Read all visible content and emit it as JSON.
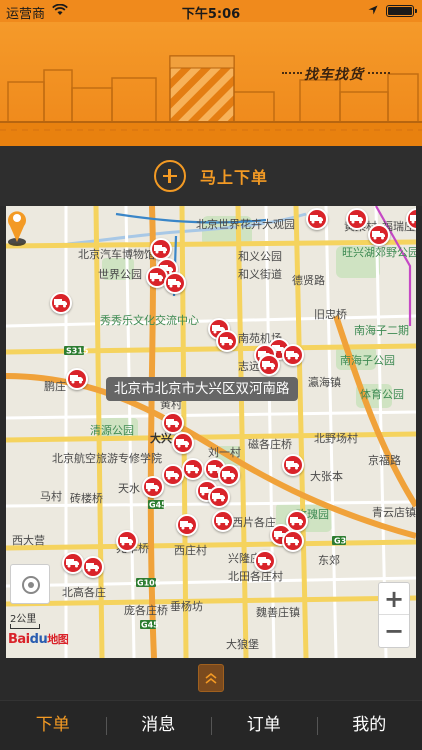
{
  "status_bar": {
    "carrier": "运营商",
    "time": "下午5:06"
  },
  "banner": {
    "title": "找车找货"
  },
  "order_bar": {
    "label": "马上下单"
  },
  "map": {
    "address": "北京市北京市大兴区双河南路",
    "scale": "2公里",
    "logo_main": "Bai",
    "logo_paw": "du",
    "logo_suffix": "地图",
    "zoom_in": "+",
    "zoom_out": "−",
    "place_labels": [
      "北京世界花卉大观园",
      "北京汽车博物馆",
      "世界公园",
      "和义公园",
      "和义街道",
      "秀秀乐文化交流中心",
      "南苑机场",
      "德贤路",
      "旺兴湖郊野公园北区",
      "旧忠桥",
      "南海子二期",
      "南海子公园",
      "志远",
      "瀛海镇",
      "体育公园",
      "鹏庄",
      "黄村",
      "清源公园",
      "北京航空旅游专修学院",
      "大兴",
      "刘一村",
      "磁各庄桥",
      "北野场村",
      "大张本",
      "京福路",
      "天水",
      "砖楼桥",
      "马村",
      "兆丰桥",
      "西庄村",
      "兴隆庄村",
      "北田各庄村",
      "魏善庄镇",
      "庞各庄桥",
      "垂杨坊",
      "北高各庄",
      "玫瑰园",
      "青云店镇",
      "大狼堡",
      "西大营",
      "东郊",
      "福瑞庄",
      "黄渠村",
      "西片各庄"
    ]
  },
  "tabbar": {
    "tabs": [
      "下单",
      "消息",
      "订单",
      "我的"
    ],
    "active_index": 0
  },
  "colors": {
    "accent": "#f39a24",
    "banner": "#ee8719",
    "marker": "#d9232a",
    "dark_bg": "#2a2a2a"
  },
  "icons": {
    "marker": "truck-marker-icon",
    "pin": "location-pin-icon",
    "locate": "locate-icon",
    "handle": "chevron-up-icon"
  }
}
